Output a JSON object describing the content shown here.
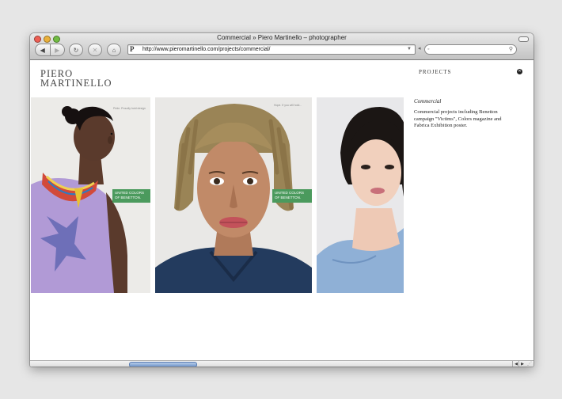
{
  "window": {
    "title": "Commercial » Piero Martinello – photographer"
  },
  "toolbar": {
    "back_glyph": "◀",
    "forward_glyph": "▶",
    "reload_glyph": "↻",
    "stop_glyph": "✕",
    "home_glyph": "⌂",
    "favicon_letter": "P",
    "url": "http://www.pieromartinello.com/projects/commercial/",
    "url_dropdown_glyph": "▼",
    "search_placeholder": "",
    "search_icon": "magnifier-icon"
  },
  "site": {
    "logo_line1": "PIERO",
    "logo_line2": "MARTINELLO",
    "nav_projects": "PROJECTS",
    "close_glyph": "✕"
  },
  "gallery": {
    "photos": [
      {
        "subject": "woman in lavender top with beaded necklace",
        "tiny_caption": "Pride. Proudly hold design",
        "badge": "UNITED COLORS OF BENETTON."
      },
      {
        "subject": "man with blond dreadlocks",
        "tiny_caption": "Hope. If you will hold...",
        "badge": "UNITED COLORS OF BENETTON."
      },
      {
        "subject": "woman with short black hair in blue top"
      }
    ]
  },
  "sidebar": {
    "title": "Commercial",
    "description": "Commercial projects including Benetton campaign \"Victims\", Colors magazine and Fabrica Exhibition poster."
  },
  "colors": {
    "benetton_green": "#4b9a5d",
    "scroll_thumb": "#6d94cc"
  }
}
